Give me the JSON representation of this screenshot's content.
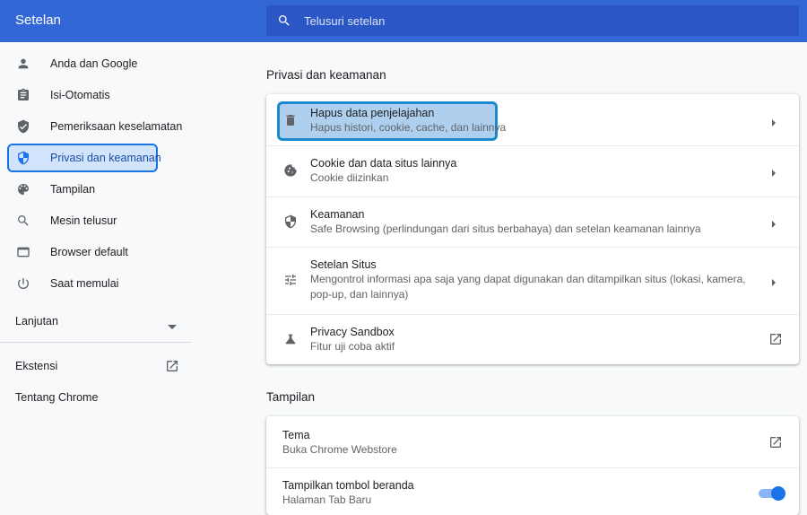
{
  "app": {
    "title": "Setelan"
  },
  "search": {
    "placeholder": "Telusuri setelan"
  },
  "sidebar": {
    "items": [
      {
        "label": "Anda dan Google",
        "icon": "person-icon"
      },
      {
        "label": "Isi-Otomatis",
        "icon": "clipboard-icon"
      },
      {
        "label": "Pemeriksaan keselamatan",
        "icon": "shield-check-icon"
      },
      {
        "label": "Privasi dan keamanan",
        "icon": "shield-icon",
        "active": true
      },
      {
        "label": "Tampilan",
        "icon": "palette-icon"
      },
      {
        "label": "Mesin telusur",
        "icon": "search-icon"
      },
      {
        "label": "Browser default",
        "icon": "browser-icon"
      },
      {
        "label": "Saat memulai",
        "icon": "power-icon"
      }
    ],
    "advanced_label": "Lanjutan",
    "extensions_label": "Ekstensi",
    "about_label": "Tentang Chrome"
  },
  "privacy": {
    "heading": "Privasi dan keamanan",
    "rows": [
      {
        "title": "Hapus data penjelajahan",
        "subtitle": "Hapus histori, cookie, cache, dan lainnya",
        "icon": "trash-icon"
      },
      {
        "title": "Cookie dan data situs lainnya",
        "subtitle": "Cookie diizinkan",
        "icon": "cookie-icon"
      },
      {
        "title": "Keamanan",
        "subtitle": "Safe Browsing (perlindungan dari situs berbahaya) dan setelan keamanan lainnya",
        "icon": "shield-icon"
      },
      {
        "title": "Setelan Situs",
        "subtitle": "Mengontrol informasi apa saja yang dapat digunakan dan ditampilkan situs (lokasi, kamera, pop-up, dan lainnya)",
        "icon": "sliders-icon"
      },
      {
        "title": "Privacy Sandbox",
        "subtitle": "Fitur uji coba aktif",
        "icon": "flask-icon"
      }
    ]
  },
  "appearance": {
    "heading": "Tampilan",
    "rows": [
      {
        "title": "Tema",
        "subtitle": "Buka Chrome Webstore"
      },
      {
        "title": "Tampilkan tombol beranda",
        "subtitle": "Halaman Tab Baru",
        "toggle_on": true
      }
    ]
  },
  "colors": {
    "accent": "#1a73e8",
    "topbar": "#3367d6",
    "highlight": "#1a8ad0"
  }
}
